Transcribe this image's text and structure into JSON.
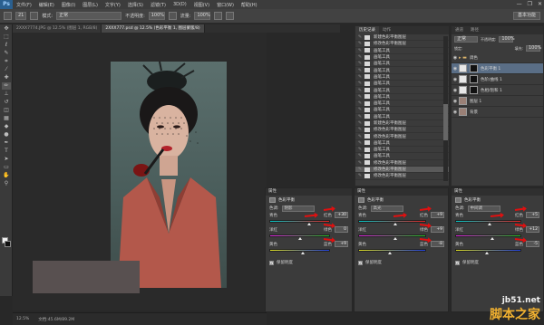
{
  "menubar": {
    "logo": "Ps",
    "items": [
      "文件(F)",
      "编辑(E)",
      "图像(I)",
      "图层(L)",
      "文字(Y)",
      "选择(S)",
      "滤镜(T)",
      "3D(D)",
      "视图(V)",
      "窗口(W)",
      "帮助(H)"
    ],
    "window_controls": [
      "—",
      "❐",
      "✕"
    ]
  },
  "optionsbar": {
    "brush_size": "21",
    "mode_label": "模式:",
    "mode_value": "正常",
    "opacity_label": "不透明度:",
    "opacity_value": "100%",
    "flow_label": "流量:",
    "flow_value": "100%",
    "workspace": "基本功能"
  },
  "doctabs": [
    {
      "label": "2XXX7774.JPG @ 12.5% (图层 1, RGB/8)",
      "active": false
    },
    {
      "label": "2XXX777.psd @ 12.5% (色彩平衡 1, 图层蒙版/8)",
      "active": true
    }
  ],
  "statusbar": {
    "zoom": "12.5%",
    "doc": "文档:45.6M/89.2M"
  },
  "history": {
    "tabs": [
      "历史记录",
      "动作"
    ],
    "items": [
      "新建色彩平衡图层",
      "修改色彩平衡图层",
      "画笔工具",
      "画笔工具",
      "画笔工具",
      "画笔工具",
      "画笔工具",
      "画笔工具",
      "画笔工具",
      "画笔工具",
      "画笔工具",
      "画笔工具",
      "画笔工具",
      "新建色彩平衡图层",
      "修改色彩平衡图层",
      "修改色彩平衡图层",
      "画笔工具",
      "画笔工具",
      "画笔工具",
      "修改色彩平衡图层",
      "修改色彩平衡图层",
      "修改色彩平衡图层"
    ],
    "selected_index": 20
  },
  "layers": {
    "tabs": [
      "通道",
      "路径"
    ],
    "blend_mode": "正常",
    "opacity_label": "不透明度:",
    "opacity_value": "100%",
    "lock_label": "锁定:",
    "fill_label": "填充:",
    "fill_value": "100%",
    "rows": [
      {
        "name": "调色",
        "kind": "group"
      },
      {
        "name": "色彩平衡 1",
        "kind": "adjust",
        "selected": true
      },
      {
        "name": "色阶/曲线 1",
        "kind": "adjust"
      },
      {
        "name": "色相/饱和 1",
        "kind": "adjust"
      },
      {
        "name": "图层 1",
        "kind": "pixel"
      },
      {
        "name": "背景",
        "kind": "pixel"
      }
    ]
  },
  "props_panels": [
    {
      "header": "属性",
      "title": "色彩平衡",
      "tone_label": "色调:",
      "tone_value": "阴影",
      "sliders": [
        {
          "left": "青色",
          "right": "红色",
          "value": "+30"
        },
        {
          "left": "洋红",
          "right": "绿色",
          "value": "0"
        },
        {
          "left": "黄色",
          "right": "蓝色",
          "value": "+9"
        }
      ],
      "preserve": "保留明度"
    },
    {
      "header": "属性",
      "title": "色彩平衡",
      "tone_label": "色调:",
      "tone_value": "高光",
      "sliders": [
        {
          "left": "青色",
          "right": "红色",
          "value": "+9"
        },
        {
          "left": "洋红",
          "right": "绿色",
          "value": "+9"
        },
        {
          "left": "黄色",
          "right": "蓝色",
          "value": "-8"
        }
      ],
      "preserve": "保留明度"
    },
    {
      "header": "属性",
      "title": "色彩平衡",
      "tone_label": "色调:",
      "tone_value": "中间调",
      "sliders": [
        {
          "left": "青色",
          "right": "红色",
          "value": "+5"
        },
        {
          "left": "洋红",
          "right": "绿色",
          "value": "+12"
        },
        {
          "left": "黄色",
          "right": "蓝色",
          "value": "-5"
        }
      ],
      "preserve": "保留明度"
    }
  ],
  "watermark": {
    "url": "jb51.net",
    "cn": "脚本之家"
  },
  "colors": {
    "accent": "#2a5f8f",
    "arrow": "#e01010",
    "swatch": "#585050"
  }
}
